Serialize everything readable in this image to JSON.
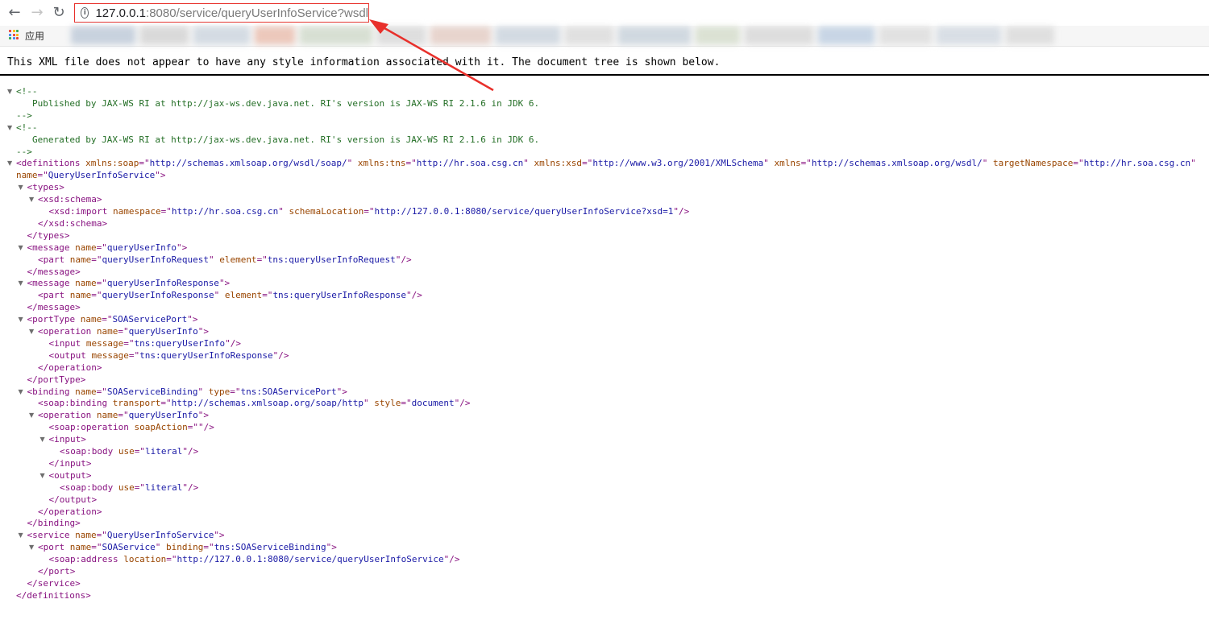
{
  "browser": {
    "url_host": "127.0.0.1",
    "url_rest": ":8080/service/queryUserInfoService?wsdl",
    "back_icon": "arrow-left-icon",
    "forward_icon": "arrow-right-icon",
    "reload_icon": "reload-icon",
    "site_info_icon": "info-icon",
    "bookmarks_apps_label": "应用"
  },
  "xml": {
    "header_message": "This XML file does not appear to have any style information associated with it. The document tree is shown below.",
    "comments": [
      {
        "open": "<!--",
        "text": "Published by JAX-WS RI at http://jax-ws.dev.java.net. RI's version is JAX-WS RI 2.1.6 in JDK 6.",
        "close": "-->"
      },
      {
        "open": "<!--",
        "text": "Generated by JAX-WS RI at http://jax-ws.dev.java.net. RI's version is JAX-WS RI 2.1.6 in JDK 6.",
        "close": "-->"
      }
    ],
    "lines": [
      {
        "ind": 0,
        "tri": true,
        "parts": [
          [
            "t",
            "<definitions"
          ],
          [
            "a",
            " xmlns:soap"
          ],
          [
            "t",
            "=\""
          ],
          [
            "v",
            "http://schemas.xmlsoap.org/wsdl/soap/"
          ],
          [
            "t",
            "\""
          ],
          [
            "a",
            " xmlns:tns"
          ],
          [
            "t",
            "=\""
          ],
          [
            "v",
            "http://hr.soa.csg.cn"
          ],
          [
            "t",
            "\""
          ],
          [
            "a",
            " xmlns:xsd"
          ],
          [
            "t",
            "=\""
          ],
          [
            "v",
            "http://www.w3.org/2001/XMLSchema"
          ],
          [
            "t",
            "\""
          ],
          [
            "a",
            " xmlns"
          ],
          [
            "t",
            "=\""
          ],
          [
            "v",
            "http://schemas.xmlsoap.org/wsdl/"
          ],
          [
            "t",
            "\""
          ],
          [
            "a",
            " targetNamespace"
          ],
          [
            "t",
            "=\""
          ],
          [
            "v",
            "http://hr.soa.csg.cn"
          ],
          [
            "t",
            "\""
          ]
        ]
      },
      {
        "ind": 0,
        "tri": false,
        "parts": [
          [
            "a",
            "name"
          ],
          [
            "t",
            "=\""
          ],
          [
            "v",
            "QueryUserInfoService"
          ],
          [
            "t",
            "\">"
          ]
        ]
      },
      {
        "ind": 1,
        "tri": true,
        "parts": [
          [
            "t",
            "<types>"
          ]
        ]
      },
      {
        "ind": 2,
        "tri": true,
        "parts": [
          [
            "t",
            "<xsd:schema>"
          ]
        ]
      },
      {
        "ind": 3,
        "tri": false,
        "parts": [
          [
            "t",
            "<xsd:import"
          ],
          [
            "a",
            " namespace"
          ],
          [
            "t",
            "=\""
          ],
          [
            "v",
            "http://hr.soa.csg.cn"
          ],
          [
            "t",
            "\""
          ],
          [
            "a",
            " schemaLocation"
          ],
          [
            "t",
            "=\""
          ],
          [
            "v",
            "http://127.0.0.1:8080/service/queryUserInfoService?xsd=1"
          ],
          [
            "t",
            "\"/>"
          ]
        ]
      },
      {
        "ind": 2,
        "tri": false,
        "parts": [
          [
            "t",
            "</xsd:schema>"
          ]
        ]
      },
      {
        "ind": 1,
        "tri": false,
        "parts": [
          [
            "t",
            "</types>"
          ]
        ]
      },
      {
        "ind": 1,
        "tri": true,
        "parts": [
          [
            "t",
            "<message"
          ],
          [
            "a",
            " name"
          ],
          [
            "t",
            "=\""
          ],
          [
            "v",
            "queryUserInfo"
          ],
          [
            "t",
            "\">"
          ]
        ]
      },
      {
        "ind": 2,
        "tri": false,
        "parts": [
          [
            "t",
            "<part"
          ],
          [
            "a",
            " name"
          ],
          [
            "t",
            "=\""
          ],
          [
            "v",
            "queryUserInfoRequest"
          ],
          [
            "t",
            "\""
          ],
          [
            "a",
            " element"
          ],
          [
            "t",
            "=\""
          ],
          [
            "v",
            "tns:queryUserInfoRequest"
          ],
          [
            "t",
            "\"/>"
          ]
        ]
      },
      {
        "ind": 1,
        "tri": false,
        "parts": [
          [
            "t",
            "</message>"
          ]
        ]
      },
      {
        "ind": 1,
        "tri": true,
        "parts": [
          [
            "t",
            "<message"
          ],
          [
            "a",
            " name"
          ],
          [
            "t",
            "=\""
          ],
          [
            "v",
            "queryUserInfoResponse"
          ],
          [
            "t",
            "\">"
          ]
        ]
      },
      {
        "ind": 2,
        "tri": false,
        "parts": [
          [
            "t",
            "<part"
          ],
          [
            "a",
            " name"
          ],
          [
            "t",
            "=\""
          ],
          [
            "v",
            "queryUserInfoResponse"
          ],
          [
            "t",
            "\""
          ],
          [
            "a",
            " element"
          ],
          [
            "t",
            "=\""
          ],
          [
            "v",
            "tns:queryUserInfoResponse"
          ],
          [
            "t",
            "\"/>"
          ]
        ]
      },
      {
        "ind": 1,
        "tri": false,
        "parts": [
          [
            "t",
            "</message>"
          ]
        ]
      },
      {
        "ind": 1,
        "tri": true,
        "parts": [
          [
            "t",
            "<portType"
          ],
          [
            "a",
            " name"
          ],
          [
            "t",
            "=\""
          ],
          [
            "v",
            "SOAServicePort"
          ],
          [
            "t",
            "\">"
          ]
        ]
      },
      {
        "ind": 2,
        "tri": true,
        "parts": [
          [
            "t",
            "<operation"
          ],
          [
            "a",
            " name"
          ],
          [
            "t",
            "=\""
          ],
          [
            "v",
            "queryUserInfo"
          ],
          [
            "t",
            "\">"
          ]
        ]
      },
      {
        "ind": 3,
        "tri": false,
        "parts": [
          [
            "t",
            "<input"
          ],
          [
            "a",
            " message"
          ],
          [
            "t",
            "=\""
          ],
          [
            "v",
            "tns:queryUserInfo"
          ],
          [
            "t",
            "\"/>"
          ]
        ]
      },
      {
        "ind": 3,
        "tri": false,
        "parts": [
          [
            "t",
            "<output"
          ],
          [
            "a",
            " message"
          ],
          [
            "t",
            "=\""
          ],
          [
            "v",
            "tns:queryUserInfoResponse"
          ],
          [
            "t",
            "\"/>"
          ]
        ]
      },
      {
        "ind": 2,
        "tri": false,
        "parts": [
          [
            "t",
            "</operation>"
          ]
        ]
      },
      {
        "ind": 1,
        "tri": false,
        "parts": [
          [
            "t",
            "</portType>"
          ]
        ]
      },
      {
        "ind": 1,
        "tri": true,
        "parts": [
          [
            "t",
            "<binding"
          ],
          [
            "a",
            " name"
          ],
          [
            "t",
            "=\""
          ],
          [
            "v",
            "SOAServiceBinding"
          ],
          [
            "t",
            "\""
          ],
          [
            "a",
            " type"
          ],
          [
            "t",
            "=\""
          ],
          [
            "v",
            "tns:SOAServicePort"
          ],
          [
            "t",
            "\">"
          ]
        ]
      },
      {
        "ind": 2,
        "tri": false,
        "parts": [
          [
            "t",
            "<soap:binding"
          ],
          [
            "a",
            " transport"
          ],
          [
            "t",
            "=\""
          ],
          [
            "v",
            "http://schemas.xmlsoap.org/soap/http"
          ],
          [
            "t",
            "\""
          ],
          [
            "a",
            " style"
          ],
          [
            "t",
            "=\""
          ],
          [
            "v",
            "document"
          ],
          [
            "t",
            "\"/>"
          ]
        ]
      },
      {
        "ind": 2,
        "tri": true,
        "parts": [
          [
            "t",
            "<operation"
          ],
          [
            "a",
            " name"
          ],
          [
            "t",
            "=\""
          ],
          [
            "v",
            "queryUserInfo"
          ],
          [
            "t",
            "\">"
          ]
        ]
      },
      {
        "ind": 3,
        "tri": false,
        "parts": [
          [
            "t",
            "<soap:operation"
          ],
          [
            "a",
            " soapAction"
          ],
          [
            "t",
            "=\"\"/>"
          ]
        ]
      },
      {
        "ind": 3,
        "tri": true,
        "parts": [
          [
            "t",
            "<input>"
          ]
        ]
      },
      {
        "ind": 4,
        "tri": false,
        "parts": [
          [
            "t",
            "<soap:body"
          ],
          [
            "a",
            " use"
          ],
          [
            "t",
            "=\""
          ],
          [
            "v",
            "literal"
          ],
          [
            "t",
            "\"/>"
          ]
        ]
      },
      {
        "ind": 3,
        "tri": false,
        "parts": [
          [
            "t",
            "</input>"
          ]
        ]
      },
      {
        "ind": 3,
        "tri": true,
        "parts": [
          [
            "t",
            "<output>"
          ]
        ]
      },
      {
        "ind": 4,
        "tri": false,
        "parts": [
          [
            "t",
            "<soap:body"
          ],
          [
            "a",
            " use"
          ],
          [
            "t",
            "=\""
          ],
          [
            "v",
            "literal"
          ],
          [
            "t",
            "\"/>"
          ]
        ]
      },
      {
        "ind": 3,
        "tri": false,
        "parts": [
          [
            "t",
            "</output>"
          ]
        ]
      },
      {
        "ind": 2,
        "tri": false,
        "parts": [
          [
            "t",
            "</operation>"
          ]
        ]
      },
      {
        "ind": 1,
        "tri": false,
        "parts": [
          [
            "t",
            "</binding>"
          ]
        ]
      },
      {
        "ind": 1,
        "tri": true,
        "parts": [
          [
            "t",
            "<service"
          ],
          [
            "a",
            " name"
          ],
          [
            "t",
            "=\""
          ],
          [
            "v",
            "QueryUserInfoService"
          ],
          [
            "t",
            "\">"
          ]
        ]
      },
      {
        "ind": 2,
        "tri": true,
        "parts": [
          [
            "t",
            "<port"
          ],
          [
            "a",
            " name"
          ],
          [
            "t",
            "=\""
          ],
          [
            "v",
            "SOAService"
          ],
          [
            "t",
            "\""
          ],
          [
            "a",
            " binding"
          ],
          [
            "t",
            "=\""
          ],
          [
            "v",
            "tns:SOAServiceBinding"
          ],
          [
            "t",
            "\">"
          ]
        ]
      },
      {
        "ind": 3,
        "tri": false,
        "parts": [
          [
            "t",
            "<soap:address"
          ],
          [
            "a",
            " location"
          ],
          [
            "t",
            "=\""
          ],
          [
            "v",
            "http://127.0.0.1:8080/service/queryUserInfoService"
          ],
          [
            "t",
            "\"/>"
          ]
        ]
      },
      {
        "ind": 2,
        "tri": false,
        "parts": [
          [
            "t",
            "</port>"
          ]
        ]
      },
      {
        "ind": 1,
        "tri": false,
        "parts": [
          [
            "t",
            "</service>"
          ]
        ]
      },
      {
        "ind": 0,
        "tri": false,
        "parts": [
          [
            "t",
            "</definitions>"
          ]
        ]
      }
    ]
  },
  "annotation": {
    "color": "#e8302b"
  }
}
